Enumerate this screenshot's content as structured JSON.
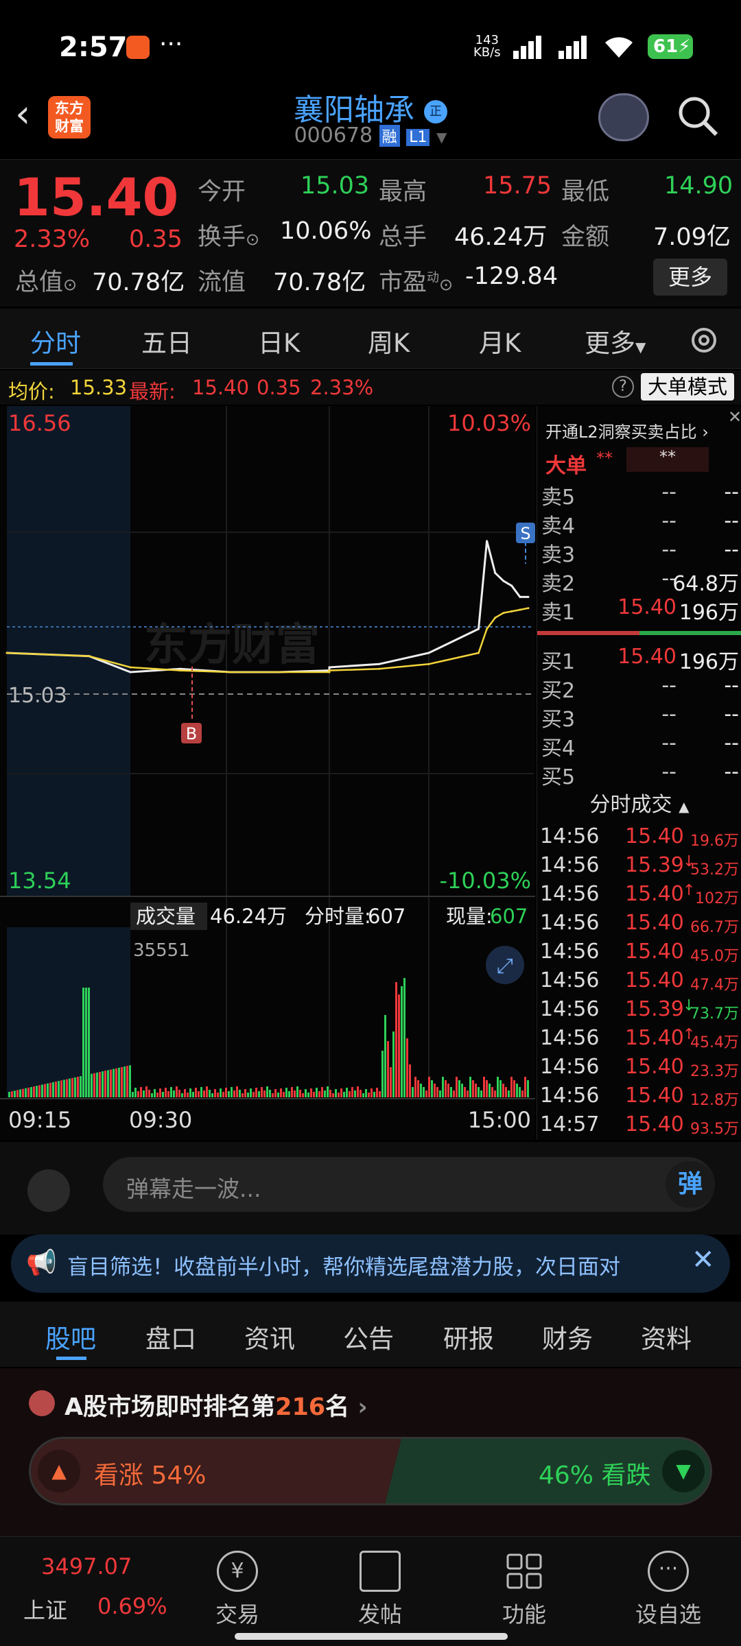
{
  "status": {
    "time": "2:57",
    "speed": "143",
    "speed_unit": "KB/s",
    "battery": "61"
  },
  "header": {
    "logo": "东方财富",
    "name": "襄阳轴承",
    "code": "000678",
    "tag_rong": "融",
    "tag_l1": "L1"
  },
  "quote": {
    "price": "15.40",
    "pct": "2.33%",
    "change": "0.35",
    "open_label": "今开",
    "open": "15.03",
    "high_label": "最高",
    "high": "15.75",
    "low_label": "最低",
    "low": "14.90",
    "turnover_label": "换手",
    "turnover": "10.06%",
    "volume_label": "总手",
    "volume": "46.24万",
    "amount_label": "金额",
    "amount": "7.09亿",
    "mktcap_label": "总值",
    "mktcap": "70.78亿",
    "float_label": "流值",
    "float": "70.78亿",
    "pe_label": "市盈",
    "pe_sup": "动",
    "pe": "-129.84",
    "more": "更多"
  },
  "tabs": [
    "分时",
    "五日",
    "日K",
    "周K",
    "月K",
    "更多"
  ],
  "info": {
    "avg_label": "均价:",
    "avg": "15.33",
    "latest_label": "最新:",
    "latest": "15.40",
    "change": "0.35",
    "pct": "2.33%",
    "mode_btn": "大单模式"
  },
  "chart": {
    "y_high": "16.56",
    "y_low": "13.54",
    "pct_high": "10.03%",
    "pct_low": "-10.03%",
    "ref_price": "15.03",
    "watermark": "东方财富",
    "marker_b": "B",
    "marker_s": "S",
    "vol_label": "成交量",
    "vol_total": "46.24万",
    "minute_vol_label": "分时量:",
    "minute_vol": "607",
    "now_label": "现量:",
    "now": "607",
    "vol_max": "35551",
    "x_labels": [
      "09:15",
      "09:30",
      "15:00"
    ]
  },
  "chart_data": {
    "type": "line",
    "title": "",
    "xlabel": "",
    "ylabel": "",
    "ylim": [
      13.54,
      16.56
    ],
    "x": [
      "09:15",
      "09:25",
      "09:30",
      "09:45",
      "10:00",
      "10:30",
      "11:00",
      "11:30",
      "13:00",
      "13:30",
      "14:00",
      "14:30",
      "14:35",
      "14:40",
      "14:45",
      "14:50",
      "14:55",
      "15:00"
    ],
    "series": [
      {
        "values": [
          15.05,
          15.03,
          14.93,
          14.94,
          14.95,
          14.93,
          14.93,
          14.94,
          14.96,
          14.98,
          15.05,
          15.2,
          15.75,
          15.55,
          15.5,
          15.47,
          15.4,
          15.4
        ]
      },
      {
        "values": [
          15.05,
          15.03,
          14.96,
          14.95,
          14.94,
          14.93,
          14.93,
          14.93,
          14.94,
          14.95,
          14.98,
          15.05,
          15.2,
          15.27,
          15.3,
          15.31,
          15.32,
          15.33
        ]
      }
    ],
    "volume": {
      "ymax": 35551
    }
  },
  "orderbook": {
    "title": "开通L2洞察买卖占比",
    "big_label": "大单",
    "big_val1": "**",
    "big_val2": "**",
    "sells": [
      {
        "label": "卖5",
        "price": "--",
        "vol": "--"
      },
      {
        "label": "卖4",
        "price": "--",
        "vol": "--"
      },
      {
        "label": "卖3",
        "price": "--",
        "vol": "--"
      },
      {
        "label": "卖2",
        "price": "--",
        "vol": "64.8万"
      },
      {
        "label": "卖1",
        "price": "15.40",
        "vol": "196万"
      }
    ],
    "buys": [
      {
        "label": "买1",
        "price": "15.40",
        "vol": "196万"
      },
      {
        "label": "买2",
        "price": "--",
        "vol": "--"
      },
      {
        "label": "买3",
        "price": "--",
        "vol": "--"
      },
      {
        "label": "买4",
        "price": "--",
        "vol": "--"
      },
      {
        "label": "买5",
        "price": "--",
        "vol": "--"
      }
    ],
    "trades_title": "分时成交",
    "trades": [
      {
        "time": "14:56",
        "price": "15.40",
        "arrow": "",
        "vol": "19.6万",
        "c": "red"
      },
      {
        "time": "14:56",
        "price": "15.39",
        "arrow": "↓",
        "vol": "53.2万",
        "c": "red"
      },
      {
        "time": "14:56",
        "price": "15.40",
        "arrow": "↑",
        "vol": "102万",
        "c": "red"
      },
      {
        "time": "14:56",
        "price": "15.40",
        "arrow": "",
        "vol": "66.7万",
        "c": "red"
      },
      {
        "time": "14:56",
        "price": "15.40",
        "arrow": "",
        "vol": "45.0万",
        "c": "red"
      },
      {
        "time": "14:56",
        "price": "15.40",
        "arrow": "",
        "vol": "47.4万",
        "c": "red"
      },
      {
        "time": "14:56",
        "price": "15.39",
        "arrow": "↓",
        "vol": "73.7万",
        "c": "green"
      },
      {
        "time": "14:56",
        "price": "15.40",
        "arrow": "↑",
        "vol": "45.4万",
        "c": "red"
      },
      {
        "time": "14:56",
        "price": "15.40",
        "arrow": "",
        "vol": "23.3万",
        "c": "red"
      },
      {
        "time": "14:56",
        "price": "15.40",
        "arrow": "",
        "vol": "12.8万",
        "c": "red"
      },
      {
        "time": "14:57",
        "price": "15.40",
        "arrow": "",
        "vol": "93.5万",
        "c": "red"
      }
    ]
  },
  "danmu": {
    "placeholder": "弹幕走一波...",
    "btn": "弹"
  },
  "notice": {
    "text": "盲目筛选！收盘前半小时，帮你精选尾盘潜力股，次日面对"
  },
  "subtabs": [
    "股吧",
    "盘口",
    "资讯",
    "公告",
    "研报",
    "财务",
    "资料"
  ],
  "rank": {
    "prefix": "A股市场即时排名第",
    "num": "216",
    "suffix": "名",
    "up_label": "看涨",
    "up_pct": "54%",
    "down_pct": "46%",
    "down_label": "看跌"
  },
  "bottom": {
    "index_val": "3497.07",
    "index_name": "上证",
    "index_pct": "0.69%",
    "items": [
      "交易",
      "发帖",
      "功能",
      "设自选"
    ]
  }
}
